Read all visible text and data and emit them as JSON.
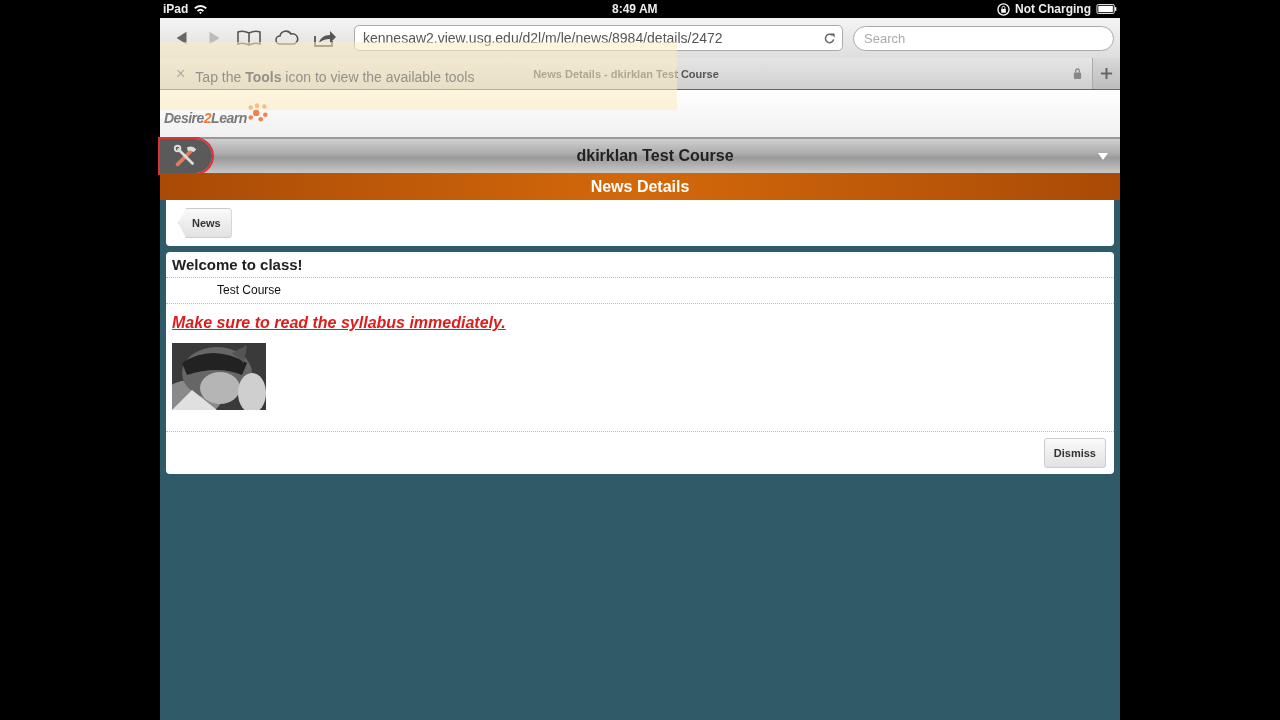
{
  "status_bar": {
    "device": "iPad",
    "time": "8:49 AM",
    "battery_text": "Not Charging"
  },
  "toolbar": {
    "url": "kennesaw2.view.usg.edu/d2l/m/le/news/8984/details/2472",
    "search": {
      "placeholder": "Search"
    }
  },
  "tab": {
    "title": "News Details - dkirklan Test Course"
  },
  "callout": {
    "close": "×",
    "text": "Tap the **Tools** icon to view the available tools"
  },
  "logo": {
    "parts": [
      "Desire",
      "2",
      "Learn"
    ]
  },
  "course": {
    "title": "dkirklan Test Course"
  },
  "page_title": "News Details",
  "breadcrumb": "News",
  "news_item": {
    "title": "Welcome to class!",
    "course": "Test Course",
    "body": "Make sure to read the syllabus immediately."
  },
  "buttons": [
    "Dismiss"
  ]
}
